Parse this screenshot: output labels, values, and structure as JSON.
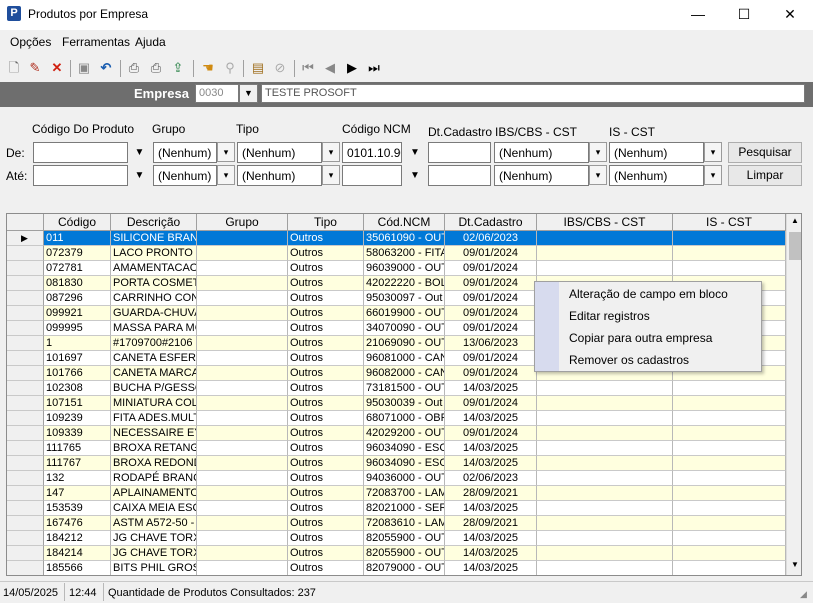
{
  "window": {
    "title": "Produtos por Empresa",
    "app_icon": "P",
    "minimize": "—",
    "maximize": "☐",
    "close": "✕"
  },
  "menu": [
    "Opções",
    "Ferramentas",
    "Ajuda"
  ],
  "empresa": {
    "label": "Empresa",
    "code": "0030",
    "name": "TESTE PROSOFT"
  },
  "filters": {
    "labels": {
      "codigo": "Código Do Produto",
      "grupo": "Grupo",
      "tipo": "Tipo",
      "ncm": "Código NCM",
      "dtcad": "Dt.Cadastro",
      "ibs": "IBS/CBS - CST",
      "is": "IS - CST",
      "de": "De:",
      "ate": "Até:"
    },
    "de": {
      "codigo": "",
      "grupo": "(Nenhum)",
      "tipo": "(Nenhum)",
      "ncm": "0101.10.90",
      "dtcad": "",
      "ibs": "(Nenhum)",
      "is": "(Nenhum)"
    },
    "ate": {
      "codigo": "",
      "grupo": "(Nenhum)",
      "tipo": "(Nenhum)",
      "ncm": "",
      "dtcad": "",
      "ibs": "(Nenhum)",
      "is": "(Nenhum)"
    },
    "pesquisar": "Pesquisar",
    "limpar": "Limpar"
  },
  "grid": {
    "columns": [
      "Código",
      "Descrição",
      "Grupo",
      "Tipo",
      "Cód.NCM",
      "Dt.Cadastro",
      "IBS/CBS - CST",
      "IS - CST"
    ],
    "rows": [
      [
        "011",
        "SILICONE BRANC",
        "",
        "Outros",
        "35061090 - OUT",
        "02/06/2023",
        "",
        ""
      ],
      [
        "072379",
        "LACO PRONTO D",
        "",
        "Outros",
        "58063200 - FITA",
        "09/01/2024",
        "",
        ""
      ],
      [
        "072781",
        "AMAMENTACAO",
        "",
        "Outros",
        "96039000 - OUT",
        "09/01/2024",
        "",
        ""
      ],
      [
        "081830",
        "PORTA COSMETI",
        "",
        "Outros",
        "42022220 - BOL",
        "09/01/2024",
        "",
        ""
      ],
      [
        "087296",
        "CARRINHO CONT",
        "",
        "Outros",
        "95030097 - Out",
        "09/01/2024",
        "",
        ""
      ],
      [
        "099921",
        "GUARDA-CHUVA",
        "",
        "Outros",
        "66019900 - OUT",
        "09/01/2024",
        "",
        ""
      ],
      [
        "099995",
        "MASSA PARA MC",
        "",
        "Outros",
        "34070090 - OUT",
        "09/01/2024",
        "",
        ""
      ],
      [
        "1",
        "#1709700#2106",
        "",
        "Outros",
        "21069090 - OUT",
        "13/06/2023",
        "",
        ""
      ],
      [
        "101697",
        "CANETA ESFERO",
        "",
        "Outros",
        "96081000 - CAN",
        "09/01/2024",
        "",
        ""
      ],
      [
        "101766",
        "CANETA MARCA",
        "",
        "Outros",
        "96082000 - CAN",
        "09/01/2024",
        "",
        ""
      ],
      [
        "102308",
        "BUCHA P/GESSO",
        "",
        "Outros",
        "73181500 - OUT",
        "14/03/2025",
        "",
        ""
      ],
      [
        "107151",
        "MINIATURA COLI",
        "",
        "Outros",
        "95030039 - Out",
        "09/01/2024",
        "",
        ""
      ],
      [
        "109239",
        "FITA ADES.MULT",
        "",
        "Outros",
        "68071000 - OBR",
        "14/03/2025",
        "",
        ""
      ],
      [
        "109339",
        "NECESSAIRE EYE",
        "",
        "Outros",
        "42029200 - OUT",
        "09/01/2024",
        "",
        ""
      ],
      [
        "111765",
        "BROXA RETANGL",
        "",
        "Outros",
        "96034090 - ESC",
        "14/03/2025",
        "",
        ""
      ],
      [
        "111767",
        "BROXA REDONDA",
        "",
        "Outros",
        "96034090 - ESC",
        "14/03/2025",
        "",
        ""
      ],
      [
        "132",
        "RODAPÉ BRANCO",
        "",
        "Outros",
        "94036000 - OUT",
        "02/06/2023",
        "",
        ""
      ],
      [
        "147",
        "APLAINAMENTO",
        "",
        "Outros",
        "72083700 - LAM",
        "28/09/2021",
        "",
        ""
      ],
      [
        "153539",
        "CAIXA MEIA ESQ",
        "",
        "Outros",
        "82021000 - SER",
        "14/03/2025",
        "",
        ""
      ],
      [
        "167476",
        "ASTM A572-50 -",
        "",
        "Outros",
        "72083610 - LAM",
        "28/09/2021",
        "",
        ""
      ],
      [
        "184212",
        "JG CHAVE TORX",
        "",
        "Outros",
        "82055900 - OUT",
        "14/03/2025",
        "",
        ""
      ],
      [
        "184214",
        "JG CHAVE TORX",
        "",
        "Outros",
        "82055900 - OUT",
        "14/03/2025",
        "",
        ""
      ],
      [
        "185566",
        "BITS PHIL GROSS",
        "",
        "Outros",
        "82079000 - OUT",
        "14/03/2025",
        "",
        ""
      ]
    ]
  },
  "context_menu": [
    "Alteração de campo em bloco",
    "Editar registros",
    "Copiar para outra empresa",
    "Remover os cadastros"
  ],
  "status": {
    "date": "14/05/2025",
    "time": "12:44",
    "message": "Quantidade de Produtos Consultados: 237"
  }
}
